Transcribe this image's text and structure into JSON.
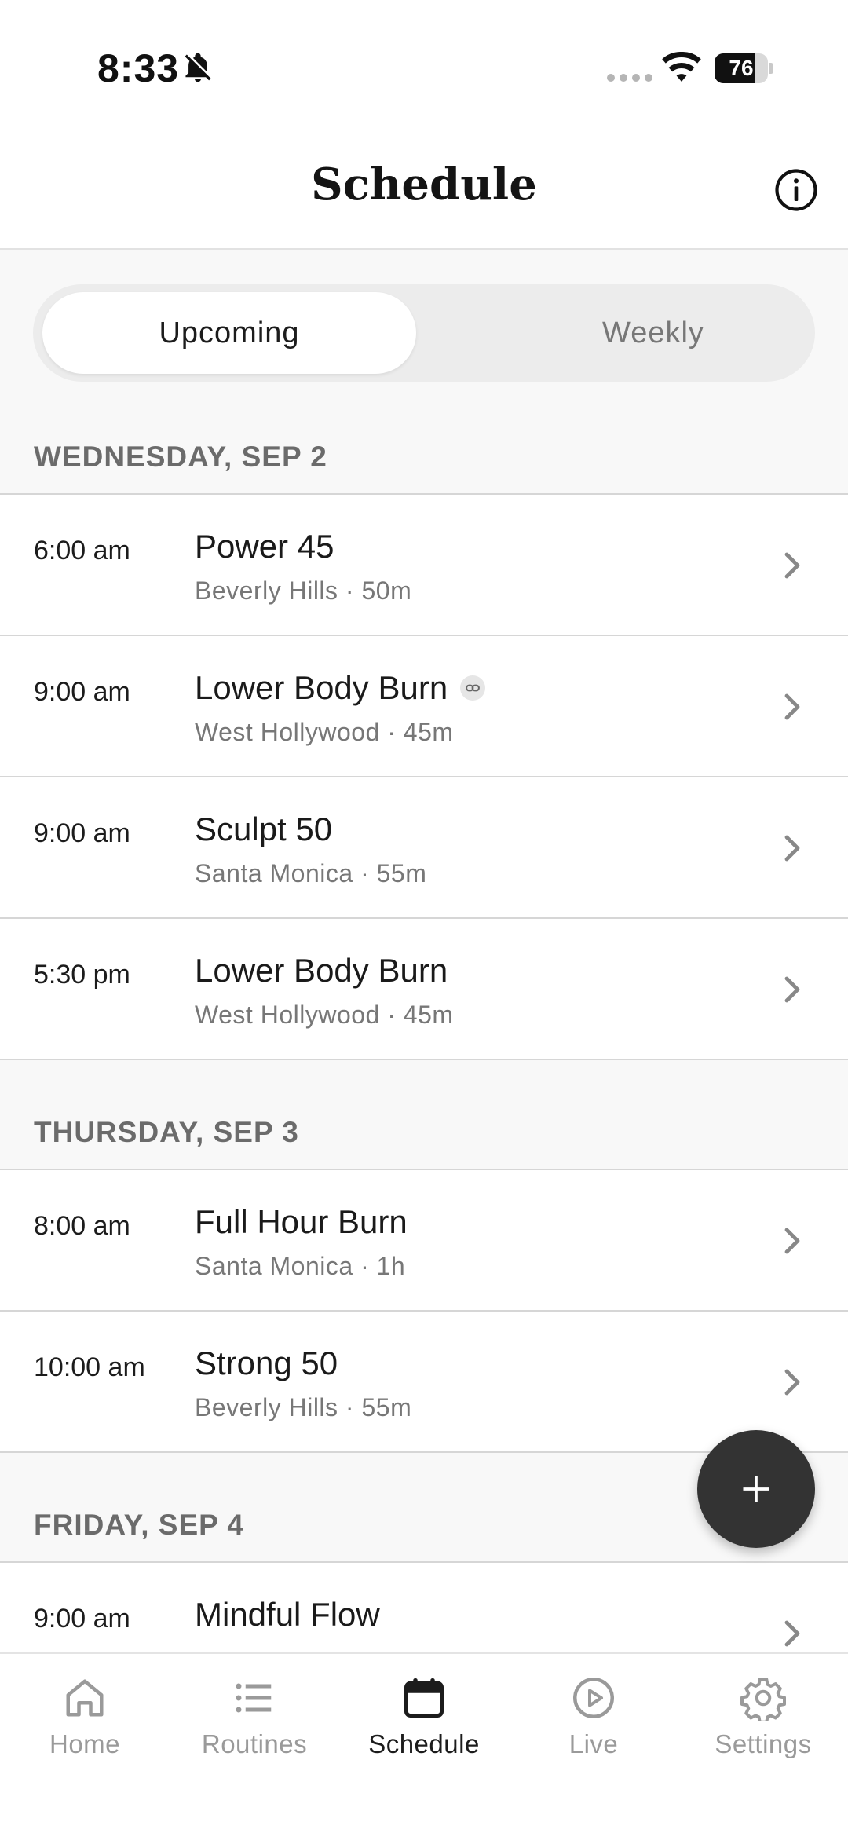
{
  "status_bar": {
    "time": "8:33",
    "battery": "76",
    "battery_level": 0.76
  },
  "header": {
    "title": "Schedule"
  },
  "segments": {
    "upcoming": "Upcoming",
    "weekly": "Weekly",
    "selected": "Upcoming"
  },
  "days": [
    {
      "label": "WEDNESDAY, SEP 2",
      "classes": [
        {
          "time": "6:00 am",
          "title": "Power 45",
          "subtitle": "Beverly Hills · 50m"
        },
        {
          "time": "9:00 am",
          "title": "Lower Body Burn",
          "subtitle": "West Hollywood · 45m",
          "icon": "link-icon"
        },
        {
          "time": "9:00 am",
          "title": "Sculpt 50",
          "subtitle": "Santa Monica · 55m"
        },
        {
          "time": "5:30 pm",
          "title": "Lower Body Burn",
          "subtitle": "West Hollywood · 45m"
        }
      ]
    },
    {
      "label": "THURSDAY, SEP 3",
      "classes": [
        {
          "time": "8:00 am",
          "title": "Full Hour Burn",
          "subtitle": "Santa Monica · 1h"
        },
        {
          "time": "10:00 am",
          "title": "Strong 50",
          "subtitle": "Beverly Hills · 55m"
        }
      ]
    },
    {
      "label": "FRIDAY, SEP 4",
      "classes": [
        {
          "time": "9:00 am",
          "title": "Mindful Flow",
          "subtitle": ""
        }
      ]
    }
  ],
  "fab": {
    "icon": "plus-icon"
  },
  "tabbar": {
    "items": [
      {
        "label": "Home",
        "icon": "home-icon"
      },
      {
        "label": "Routines",
        "icon": "list-icon"
      },
      {
        "label": "Schedule",
        "icon": "calendar-icon",
        "active": true
      },
      {
        "label": "Live",
        "icon": "play-circle-icon"
      },
      {
        "label": "Settings",
        "icon": "gear-icon"
      }
    ]
  },
  "colors": {
    "fab": "#333333",
    "text_primary": "#1c1c1c",
    "text_secondary": "#777777",
    "background": "#f8f8f8"
  }
}
